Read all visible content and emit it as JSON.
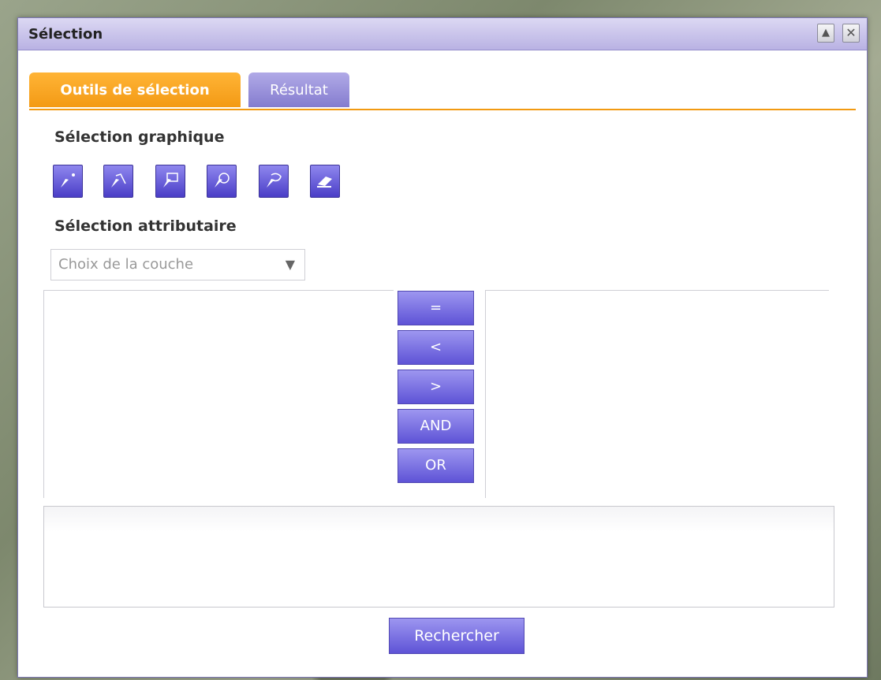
{
  "window": {
    "title": "Sélection"
  },
  "tabs": [
    {
      "label": "Outils de sélection",
      "active": true
    },
    {
      "label": "Résultat",
      "active": false
    }
  ],
  "graphic_selection": {
    "heading": "Sélection graphique",
    "tools": [
      {
        "icon": "point-select-icon"
      },
      {
        "icon": "line-select-icon"
      },
      {
        "icon": "rectangle-select-icon"
      },
      {
        "icon": "circle-select-icon"
      },
      {
        "icon": "polygon-select-icon"
      },
      {
        "icon": "eraser-icon"
      }
    ]
  },
  "attribute_selection": {
    "heading": "Sélection attributaire",
    "layer_select": {
      "value": "Choix de la couche"
    },
    "operators": [
      "=",
      "<",
      ">",
      "AND",
      "OR"
    ],
    "search_label": "Rechercher"
  },
  "colors": {
    "accent_orange": "#f39a15",
    "button_purple": "#5e53d6",
    "titlebar": "#c8c2ec"
  }
}
